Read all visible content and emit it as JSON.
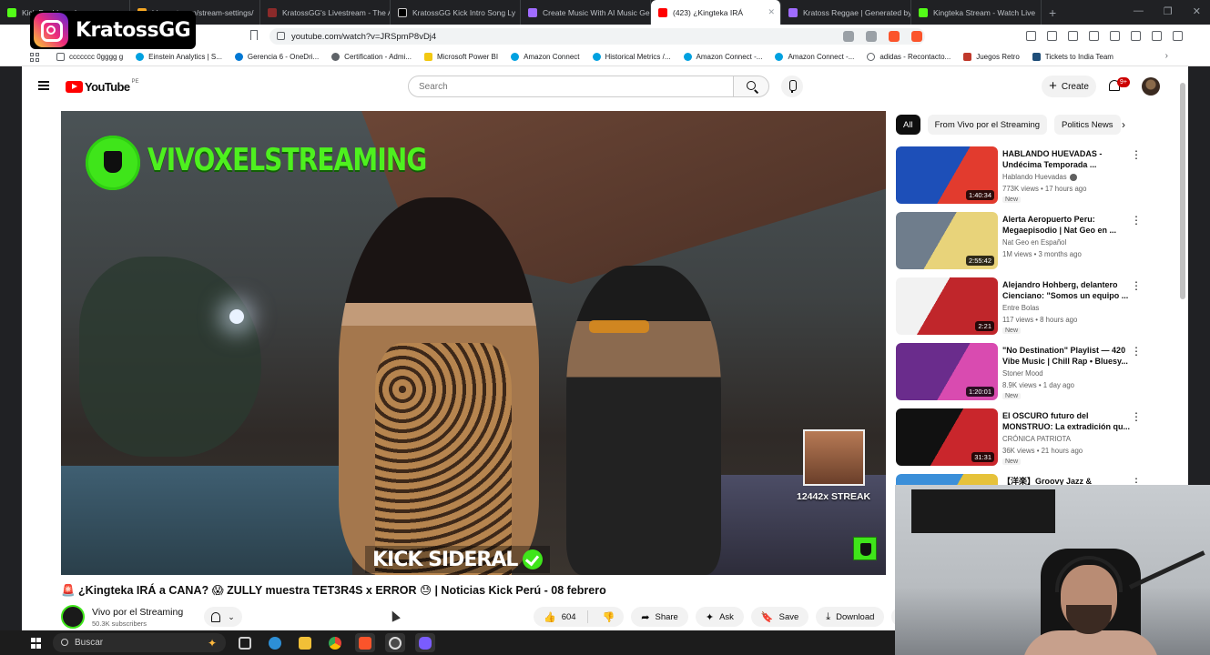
{
  "browser": {
    "tabs": [
      {
        "title": "Kick Dashboard",
        "color": "#53fc18"
      },
      {
        "title": "blaze.stream/stream-settings/",
        "color": "#f5a623"
      },
      {
        "title": "KratossGG's Livestream - The A",
        "color": "#8b2a2a"
      },
      {
        "title": "KratossGG Kick Intro Song Ly",
        "color": "#202124"
      },
      {
        "title": "Create Music With AI Music Ge",
        "color": "#a06cff"
      },
      {
        "title": "(423) ¿Kingteka IRÁ",
        "color": "#ff0000"
      },
      {
        "title": "Kratoss Reggae | Generated by",
        "color": "#a06cff"
      },
      {
        "title": "Kingteka Stream - Watch Live",
        "color": "#53fc18"
      }
    ],
    "active_tab_index": 5,
    "new_tab": "+",
    "window_controls": [
      "—",
      "❐",
      "✕"
    ],
    "url": "youtube.com/watch?v=JRSpmP8vDj4",
    "bookmarks": [
      {
        "label": "ccccccc 0gggg g",
        "color": "#5f6368"
      },
      {
        "label": "Einstein Analytics | S...",
        "color": "#00a1e0"
      },
      {
        "label": "Gerencia 6 - OneDri...",
        "color": "#0078d4"
      },
      {
        "label": "Certification - Admi...",
        "color": "#5f6368"
      },
      {
        "label": "Microsoft Power BI",
        "color": "#f2c811"
      },
      {
        "label": "Amazon Connect",
        "color": "#00a1e0"
      },
      {
        "label": "Historical Metrics /...",
        "color": "#00a1e0"
      },
      {
        "label": "Amazon Connect -...",
        "color": "#00a1e0"
      },
      {
        "label": "Amazon Connect -...",
        "color": "#00a1e0"
      },
      {
        "label": "adidas - Recontacto...",
        "color": "#5f6368"
      },
      {
        "label": "Juegos Retro",
        "color": "#c0392b"
      },
      {
        "label": "Tickets to India Team",
        "color": "#1f4e79"
      }
    ]
  },
  "overlay": {
    "instagram_name": "KratossGG"
  },
  "youtube": {
    "logo_word": "YouTube",
    "region": "PE",
    "search_placeholder": "Search",
    "create_label": "Create",
    "notification_count": "9+",
    "video": {
      "overlay_title": "VIVOXELSTREAMING",
      "streak_text": "12442x STREAK",
      "banner_text": "KICK SIDERAL",
      "title": "🚨 ¿Kingteka IRÁ a CANA? 😱 ZULLY muestra TET3R4S x ERROR 😓 | Noticias Kick Perú - 08 febrero"
    },
    "channel": {
      "name": "Vivo por el Streaming",
      "subscribers": "50.3K subscribers"
    },
    "actions": {
      "likes": "604",
      "share": "Share",
      "ask": "Ask",
      "save": "Save",
      "download": "Download"
    },
    "chips": [
      "All",
      "From Vivo por el Streaming",
      "Politics News"
    ],
    "recommendations": [
      {
        "title": "HABLANDO HUEVADAS - Undécima Temporada ...",
        "channel": "Hablando Huevadas",
        "verified": true,
        "meta": "773K views • 17 hours ago",
        "badge": "New",
        "duration": "1:40:34",
        "thumb_a": "#1d4fb8",
        "thumb_b": "#e23b2e"
      },
      {
        "title": "Alerta Aeropuerto Peru: Megaepisodio | Nat Geo en ...",
        "channel": "Nat Geo en Español",
        "verified": false,
        "meta": "1M views • 3 months ago",
        "badge": "",
        "duration": "2:55:42",
        "thumb_a": "#e8d37a",
        "thumb_b": "#6f7d8c"
      },
      {
        "title": "Alejandro Hohberg, delantero Cienciano: \"Somos un equipo ...",
        "channel": "Entre Bolas",
        "verified": false,
        "meta": "117 views • 8 hours ago",
        "badge": "New",
        "duration": "2:21",
        "thumb_a": "#c0262b",
        "thumb_b": "#f2f2f2"
      },
      {
        "title": "\"No Destination\" Playlist — 420 Vibe Music | Chill Rap • Bluesy...",
        "channel": "Stoner Mood",
        "verified": false,
        "meta": "8.9K views • 1 day ago",
        "badge": "New",
        "duration": "1:20:01",
        "thumb_a": "#6a2c8c",
        "thumb_b": "#d94bb0"
      },
      {
        "title": "El OSCURO futuro del MONSTRUO: La extradición qu...",
        "channel": "CRÓNICA PATRIOTA",
        "verified": false,
        "meta": "36K views • 21 hours ago",
        "badge": "New",
        "duration": "31:31",
        "thumb_a": "#111111",
        "thumb_b": "#c9262c"
      },
      {
        "title": "【洋楽】Groovy Jazz &",
        "channel": "",
        "verified": false,
        "meta": "",
        "badge": "",
        "duration": "",
        "thumb_a": "#3b8fd9",
        "thumb_b": "#e6c23a"
      }
    ]
  },
  "taskbar": {
    "search_placeholder": "Buscar",
    "apps": [
      {
        "name": "task-view",
        "color": "#cfcfcf"
      },
      {
        "name": "edge",
        "color": "#2d8fd6"
      },
      {
        "name": "file-explorer",
        "color": "#f2c037"
      },
      {
        "name": "chrome",
        "color": "#e94235"
      },
      {
        "name": "brave",
        "color": "#fb542b"
      },
      {
        "name": "obs",
        "color": "#4a4a4a"
      },
      {
        "name": "discord",
        "color": "#7a5cff"
      }
    ]
  }
}
